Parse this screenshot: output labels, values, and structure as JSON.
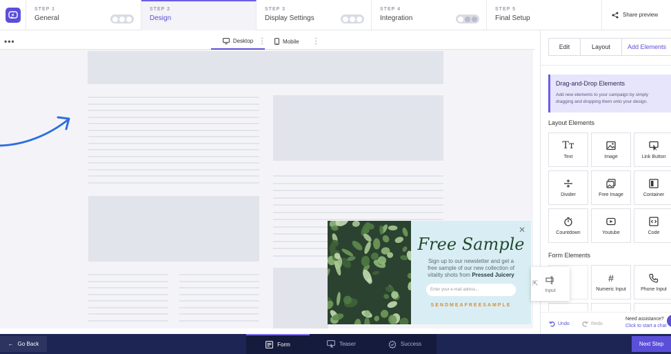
{
  "steps": [
    {
      "num": "STEP 1",
      "name": "General"
    },
    {
      "num": "STEP 2",
      "name": "Design"
    },
    {
      "num": "STEP 3",
      "name": "Display Settings"
    },
    {
      "num": "STEP 4",
      "name": "Integration"
    },
    {
      "num": "STEP 5",
      "name": "Final Setup"
    }
  ],
  "active_step": 1,
  "share_label": "Share preview",
  "canvas": {
    "desktop_label": "Desktop",
    "mobile_label": "Mobile"
  },
  "popup": {
    "title": "Free Sample",
    "subtitle_pre": "Sign up to our newsletter and get a free sample of our new collection of vitality shots from",
    "subtitle_brand": "Pressed Juicery",
    "email_placeholder": "Enter your e-mail adress...",
    "cta": "SENDMEAFREESAMPLE"
  },
  "panel": {
    "tabs": [
      "Edit",
      "Layout",
      "Add Elements"
    ],
    "active_tab": 2,
    "dd_title": "Drag-and-Drop Elements",
    "dd_text": "Add new elements to your campaign by simply dragging and dropping them onto your design.",
    "layout_title": "Layout Elements",
    "layout_elements": [
      {
        "label": "Text",
        "icon": "text-icon"
      },
      {
        "label": "Image",
        "icon": "image-icon"
      },
      {
        "label": "Link Button",
        "icon": "link-button-icon"
      },
      {
        "label": "Divider",
        "icon": "divider-icon"
      },
      {
        "label": "Free Image",
        "icon": "free-image-icon"
      },
      {
        "label": "Container",
        "icon": "container-icon"
      },
      {
        "label": "Countdown",
        "icon": "countdown-icon"
      },
      {
        "label": "Youtube",
        "icon": "youtube-icon"
      },
      {
        "label": "Code",
        "icon": "code-icon"
      }
    ],
    "form_title": "Form Elements",
    "form_elements": [
      {
        "label": "",
        "icon": ""
      },
      {
        "label": "Numeric Input",
        "icon": "hash-icon"
      },
      {
        "label": "Phone Input",
        "icon": "phone-icon"
      }
    ],
    "dragging_label": "Input",
    "undo": "Undo",
    "redo": "Redo",
    "assist_title": "Need assistance?",
    "assist_link": "Click to start a chat"
  },
  "bottom": {
    "go_back": "Go Back",
    "tabs": [
      "Form",
      "Teaser",
      "Success"
    ],
    "active_tab": 0,
    "next": "Next Step"
  },
  "colors": {
    "accent": "#5b4fd9",
    "bottom_bar": "#1d2554",
    "popup_bg": "#d9eef4",
    "cta": "#d88c3a",
    "arrow": "#2f6fe0"
  }
}
